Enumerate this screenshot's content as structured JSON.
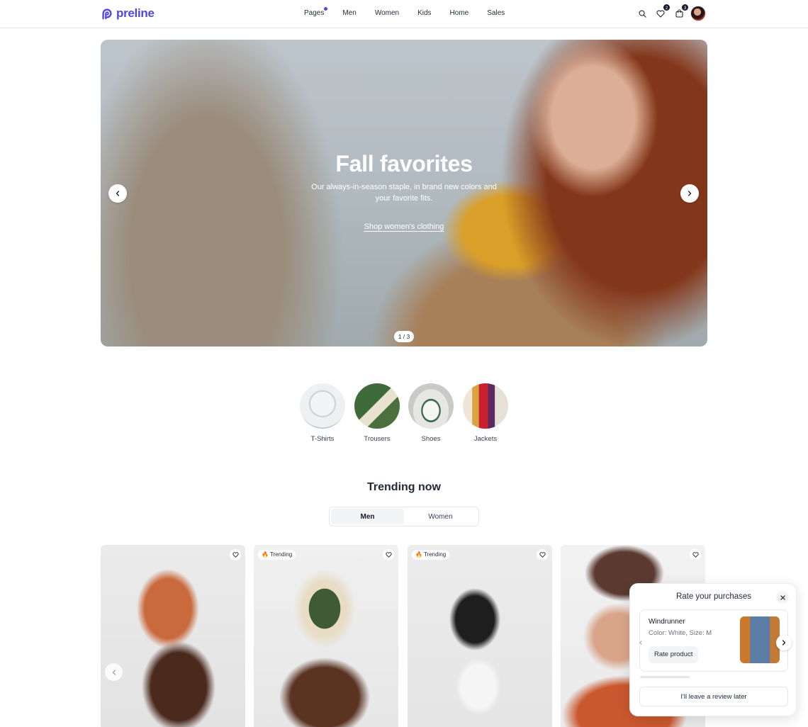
{
  "brand": {
    "name": "preline",
    "color": "#4f46e5"
  },
  "nav": {
    "items": [
      {
        "label": "Pages",
        "has_dot": true
      },
      {
        "label": "Men"
      },
      {
        "label": "Women"
      },
      {
        "label": "Kids"
      },
      {
        "label": "Home"
      },
      {
        "label": "Sales"
      }
    ]
  },
  "header_actions": {
    "search_icon": "search-icon",
    "wishlist_count": "2",
    "cart_count": "3"
  },
  "hero": {
    "title": "Fall favorites",
    "subtitle": "Our always-in-season staple, in brand new colors and your favorite fits.",
    "link": "Shop women's clothing",
    "counter": "1 / 3"
  },
  "categories": [
    {
      "label": "T-Shirts"
    },
    {
      "label": "Trousers"
    },
    {
      "label": "Shoes"
    },
    {
      "label": "Jackets"
    }
  ],
  "trending": {
    "title": "Trending now",
    "tabs": [
      {
        "label": "Men",
        "active": true
      },
      {
        "label": "Women",
        "active": false
      }
    ],
    "products": [
      {
        "tag": ""
      },
      {
        "tag": "Trending"
      },
      {
        "tag": "Trending"
      },
      {
        "tag": ""
      }
    ]
  },
  "rate_popup": {
    "title": "Rate your purchases",
    "product_name": "Windrunner",
    "product_meta": "Color: White, Size: M",
    "rate_button": "Rate product",
    "later_button": "I'll leave a review later"
  }
}
